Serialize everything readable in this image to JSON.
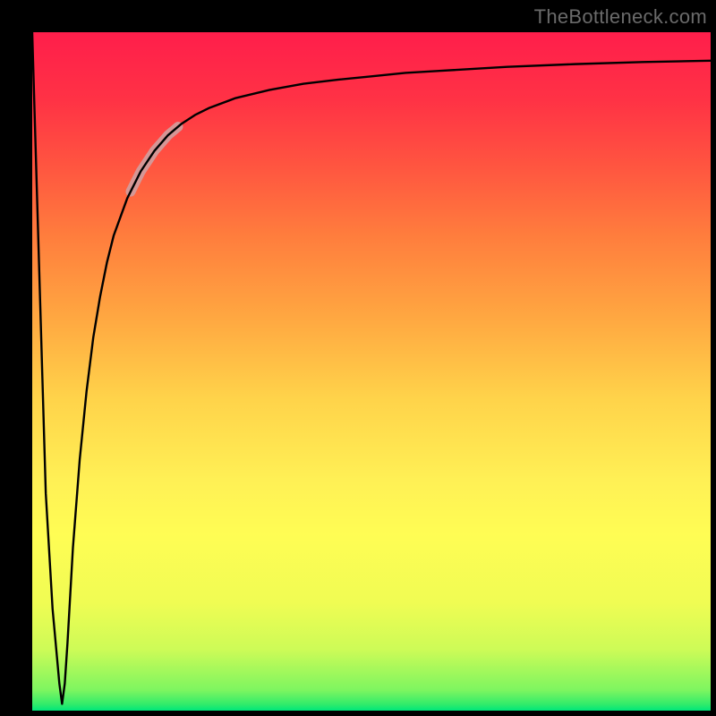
{
  "watermark": {
    "text": "TheBottleneck.com"
  },
  "colors": {
    "frame": "#000000",
    "gradient_top": "#ff1e4b",
    "gradient_bottom": "#00e67a",
    "curve": "#000000",
    "highlight": "#d39b9b"
  },
  "chart_data": {
    "type": "line",
    "title": "",
    "xlabel": "",
    "ylabel": "",
    "xlim": [
      0,
      100
    ],
    "ylim": [
      0,
      100
    ],
    "legend": false,
    "grid": false,
    "x": [
      0.0,
      0.5,
      1.0,
      1.5,
      2.0,
      3.0,
      4.0,
      4.4,
      4.8,
      5.2,
      5.6,
      6.0,
      7.0,
      8.0,
      9.0,
      10.0,
      11.0,
      12.0,
      14.0,
      16.0,
      18.0,
      20.0,
      22.0,
      24.0,
      26.0,
      30.0,
      35.0,
      40.0,
      45.0,
      50.0,
      55.0,
      60.0,
      70.0,
      80.0,
      90.0,
      100.0
    ],
    "values": [
      100.0,
      83.0,
      66.0,
      49.0,
      32.0,
      15.0,
      4.0,
      1.0,
      4.0,
      10.0,
      17.0,
      24.0,
      37.0,
      47.0,
      55.0,
      61.0,
      66.0,
      70.0,
      75.5,
      79.5,
      82.5,
      84.8,
      86.5,
      87.8,
      88.8,
      90.3,
      91.5,
      92.4,
      93.0,
      93.5,
      94.0,
      94.3,
      94.9,
      95.3,
      95.6,
      95.8
    ],
    "highlight_range_x": [
      14.5,
      21.5
    ],
    "annotations": []
  }
}
